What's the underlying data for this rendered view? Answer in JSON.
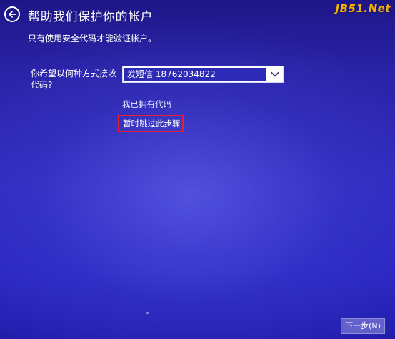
{
  "header": {
    "title": "帮助我们保护你的帐户",
    "back_icon": "back-arrow-icon"
  },
  "watermark": {
    "text": "JB51.Net",
    "color": "#f4b200"
  },
  "main": {
    "subtitle": "只有使用安全代码才能验证帐户。",
    "receive_label": "你希望以何种方式接收代码?",
    "method_select": {
      "selected_value": "发短信 18762034822",
      "dropdown_icon": "chevron-down-icon"
    },
    "have_code_link": "我已拥有代码",
    "skip_link": "暂时跳过此步骤"
  },
  "footer": {
    "next_button": "下一步(N)"
  },
  "colors": {
    "background": "#2a26b4",
    "highlight_border": "#e0213a",
    "selection": "#2d2ab8"
  }
}
